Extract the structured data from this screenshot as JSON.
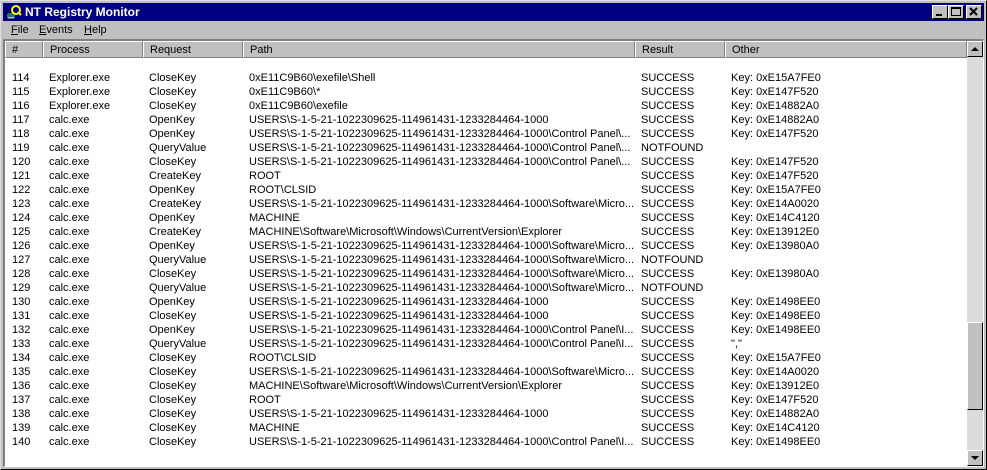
{
  "window": {
    "title": "NT Registry Monitor"
  },
  "menu": [
    {
      "label": "File",
      "accel": "F",
      "rest": "ile"
    },
    {
      "label": "Events",
      "accel": "E",
      "rest": "vents"
    },
    {
      "label": "Help",
      "accel": "H",
      "rest": "elp"
    }
  ],
  "columns": [
    "#",
    "Process",
    "Request",
    "Path",
    "Result",
    "Other"
  ],
  "scrollbar": {
    "position_fraction": 0.87
  },
  "rows": [
    {
      "num": "114",
      "process": "Explorer.exe",
      "request": "CloseKey",
      "path": "0xE11C9B60\\exefile\\Shell",
      "result": "SUCCESS",
      "other": "Key: 0xE15A7FE0"
    },
    {
      "num": "115",
      "process": "Explorer.exe",
      "request": "CloseKey",
      "path": "0xE11C9B60\\*",
      "result": "SUCCESS",
      "other": "Key: 0xE147F520"
    },
    {
      "num": "116",
      "process": "Explorer.exe",
      "request": "CloseKey",
      "path": "0xE11C9B60\\exefile",
      "result": "SUCCESS",
      "other": "Key: 0xE14882A0"
    },
    {
      "num": "117",
      "process": "calc.exe",
      "request": "OpenKey",
      "path": "USERS\\S-1-5-21-1022309625-114961431-1233284464-1000",
      "result": "SUCCESS",
      "other": "Key: 0xE14882A0"
    },
    {
      "num": "118",
      "process": "calc.exe",
      "request": "OpenKey",
      "path": "USERS\\S-1-5-21-1022309625-114961431-1233284464-1000\\Control Panel\\...",
      "result": "SUCCESS",
      "other": "Key: 0xE147F520"
    },
    {
      "num": "119",
      "process": "calc.exe",
      "request": "QueryValue",
      "path": "USERS\\S-1-5-21-1022309625-114961431-1233284464-1000\\Control Panel\\...",
      "result": "NOTFOUND",
      "other": ""
    },
    {
      "num": "120",
      "process": "calc.exe",
      "request": "CloseKey",
      "path": "USERS\\S-1-5-21-1022309625-114961431-1233284464-1000\\Control Panel\\...",
      "result": "SUCCESS",
      "other": "Key: 0xE147F520"
    },
    {
      "num": "121",
      "process": "calc.exe",
      "request": "CreateKey",
      "path": "ROOT",
      "result": "SUCCESS",
      "other": "Key: 0xE147F520"
    },
    {
      "num": "122",
      "process": "calc.exe",
      "request": "OpenKey",
      "path": "ROOT\\CLSID",
      "result": "SUCCESS",
      "other": "Key: 0xE15A7FE0"
    },
    {
      "num": "123",
      "process": "calc.exe",
      "request": "CreateKey",
      "path": "USERS\\S-1-5-21-1022309625-114961431-1233284464-1000\\Software\\Micro...",
      "result": "SUCCESS",
      "other": "Key: 0xE14A0020"
    },
    {
      "num": "124",
      "process": "calc.exe",
      "request": "OpenKey",
      "path": "MACHINE",
      "result": "SUCCESS",
      "other": "Key: 0xE14C4120"
    },
    {
      "num": "125",
      "process": "calc.exe",
      "request": "CreateKey",
      "path": "MACHINE\\Software\\Microsoft\\Windows\\CurrentVersion\\Explorer",
      "result": "SUCCESS",
      "other": "Key: 0xE13912E0"
    },
    {
      "num": "126",
      "process": "calc.exe",
      "request": "OpenKey",
      "path": "USERS\\S-1-5-21-1022309625-114961431-1233284464-1000\\Software\\Micro...",
      "result": "SUCCESS",
      "other": "Key: 0xE13980A0"
    },
    {
      "num": "127",
      "process": "calc.exe",
      "request": "QueryValue",
      "path": "USERS\\S-1-5-21-1022309625-114961431-1233284464-1000\\Software\\Micro...",
      "result": "NOTFOUND",
      "other": ""
    },
    {
      "num": "128",
      "process": "calc.exe",
      "request": "CloseKey",
      "path": "USERS\\S-1-5-21-1022309625-114961431-1233284464-1000\\Software\\Micro...",
      "result": "SUCCESS",
      "other": "Key: 0xE13980A0"
    },
    {
      "num": "129",
      "process": "calc.exe",
      "request": "QueryValue",
      "path": "USERS\\S-1-5-21-1022309625-114961431-1233284464-1000\\Software\\Micro...",
      "result": "NOTFOUND",
      "other": ""
    },
    {
      "num": "130",
      "process": "calc.exe",
      "request": "OpenKey",
      "path": "USERS\\S-1-5-21-1022309625-114961431-1233284464-1000",
      "result": "SUCCESS",
      "other": "Key: 0xE1498EE0"
    },
    {
      "num": "131",
      "process": "calc.exe",
      "request": "CloseKey",
      "path": "USERS\\S-1-5-21-1022309625-114961431-1233284464-1000",
      "result": "SUCCESS",
      "other": "Key: 0xE1498EE0"
    },
    {
      "num": "132",
      "process": "calc.exe",
      "request": "OpenKey",
      "path": "USERS\\S-1-5-21-1022309625-114961431-1233284464-1000\\Control Panel\\I...",
      "result": "SUCCESS",
      "other": "Key: 0xE1498EE0"
    },
    {
      "num": "133",
      "process": "calc.exe",
      "request": "QueryValue",
      "path": "USERS\\S-1-5-21-1022309625-114961431-1233284464-1000\\Control Panel\\I...",
      "result": "SUCCESS",
      "other": "\",\""
    },
    {
      "num": "134",
      "process": "calc.exe",
      "request": "CloseKey",
      "path": "ROOT\\CLSID",
      "result": "SUCCESS",
      "other": "Key: 0xE15A7FE0"
    },
    {
      "num": "135",
      "process": "calc.exe",
      "request": "CloseKey",
      "path": "USERS\\S-1-5-21-1022309625-114961431-1233284464-1000\\Software\\Micro...",
      "result": "SUCCESS",
      "other": "Key: 0xE14A0020"
    },
    {
      "num": "136",
      "process": "calc.exe",
      "request": "CloseKey",
      "path": "MACHINE\\Software\\Microsoft\\Windows\\CurrentVersion\\Explorer",
      "result": "SUCCESS",
      "other": "Key: 0xE13912E0"
    },
    {
      "num": "137",
      "process": "calc.exe",
      "request": "CloseKey",
      "path": "ROOT",
      "result": "SUCCESS",
      "other": "Key: 0xE147F520"
    },
    {
      "num": "138",
      "process": "calc.exe",
      "request": "CloseKey",
      "path": "USERS\\S-1-5-21-1022309625-114961431-1233284464-1000",
      "result": "SUCCESS",
      "other": "Key: 0xE14882A0"
    },
    {
      "num": "139",
      "process": "calc.exe",
      "request": "CloseKey",
      "path": "MACHINE",
      "result": "SUCCESS",
      "other": "Key: 0xE14C4120"
    },
    {
      "num": "140",
      "process": "calc.exe",
      "request": "CloseKey",
      "path": "USERS\\S-1-5-21-1022309625-114961431-1233284464-1000\\Control Panel\\I...",
      "result": "SUCCESS",
      "other": "Key: 0xE1498EE0"
    }
  ]
}
